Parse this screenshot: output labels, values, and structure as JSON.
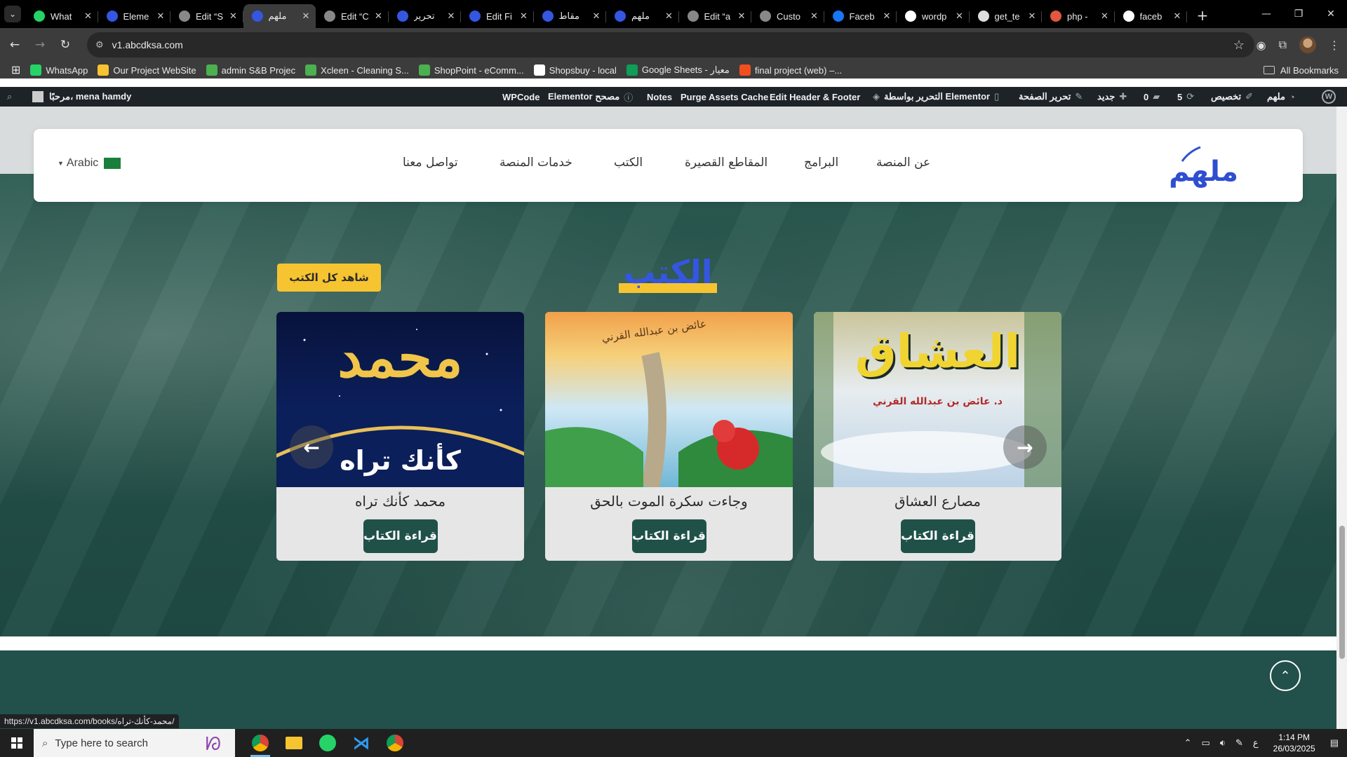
{
  "browser": {
    "tabs": [
      {
        "title": "What",
        "color": "#25d366",
        "glyph": "W"
      },
      {
        "title": "Eleme",
        "color": "#3456e0",
        "glyph": "م"
      },
      {
        "title": "Edit “S",
        "color": "#888888",
        "glyph": ""
      },
      {
        "title": "ملهم",
        "color": "#3456e0",
        "glyph": "م",
        "active": true
      },
      {
        "title": "Edit “C",
        "color": "#888888",
        "glyph": ""
      },
      {
        "title": "تحرير",
        "color": "#3456e0",
        "glyph": "م"
      },
      {
        "title": "Edit Fi",
        "color": "#3456e0",
        "glyph": "م"
      },
      {
        "title": "مقاط",
        "color": "#3456e0",
        "glyph": "م"
      },
      {
        "title": "ملهم",
        "color": "#3456e0",
        "glyph": "م"
      },
      {
        "title": "Edit “a",
        "color": "#888888",
        "glyph": ""
      },
      {
        "title": "Custo",
        "color": "#888888",
        "glyph": ""
      },
      {
        "title": "Faceb",
        "color": "#1877f2",
        "glyph": "f"
      },
      {
        "title": "wordp",
        "color": "#ffffff",
        "glyph": "G"
      },
      {
        "title": "get_te",
        "color": "#dddddd",
        "glyph": "W"
      },
      {
        "title": "php -",
        "color": "#e2583e",
        "glyph": "P"
      },
      {
        "title": "faceb",
        "color": "#ffffff",
        "glyph": "G"
      }
    ],
    "url": "v1.abcdksa.com",
    "status_url": "https://v1.abcdksa.com/books/محمد-كأنك-تراه/"
  },
  "bookmarks": [
    {
      "label": "WhatsApp",
      "color": "#25d366"
    },
    {
      "label": "Our Project WebSite",
      "color": "#f6c431"
    },
    {
      "label": "admin S&B Projec",
      "color": "#4caf50"
    },
    {
      "label": "Xcleen - Cleaning S...",
      "color": "#4caf50"
    },
    {
      "label": "ShopPoint - eComm...",
      "color": "#4caf50"
    },
    {
      "label": "Shopsbuy - local",
      "color": "#ffffff"
    },
    {
      "label": "Google Sheets - معيار",
      "color": "#0f9d58"
    },
    {
      "label": "final project (web) –...",
      "color": "#f24e1e"
    }
  ],
  "bookmarks_all": "All Bookmarks",
  "wpbar": {
    "greeting": "مرحبًا، mena hamdy",
    "wpcode": "WPCode",
    "elementor_debugger": "Elementor مصحح",
    "notes": "Notes",
    "purge": "Purge Assets Cache",
    "edit_hf": "Edit Header & Footer",
    "edit_elementor": "التحرير بواسطة Elementor",
    "edit_page": "تحرير الصفحة",
    "new": "جديد",
    "comments": "0",
    "updates": "5",
    "customize": "تخصيص",
    "site": "ملهم"
  },
  "site": {
    "logo": "ملهم",
    "menu": [
      "عن المنصة",
      "البرامج",
      "المقاطع القصيرة",
      "الكتب",
      "خدمات المنصة",
      "تواصل معنا"
    ],
    "lang": "Arabic"
  },
  "books_section": {
    "title": "الكتب",
    "view_all": "شاهد كل الكتب",
    "books": [
      {
        "title": "محمد كأنك تراه",
        "button": "قراءة الكتاب",
        "cover_text": "محمد",
        "cover_sub": "كأنك تراه"
      },
      {
        "title": "وجاءت سكرة الموت بالحق",
        "button": "قراءة الكتاب",
        "cover_text": "عائض بن عبدالله القرني"
      },
      {
        "title": "مصارع العشاق",
        "button": "قراءة الكتاب",
        "cover_text": "العشاق",
        "cover_sub": "د. عائض بن عبدالله القرني"
      }
    ]
  },
  "taskbar": {
    "search_placeholder": "Type here to search",
    "time": "1:14 PM",
    "date": "26/03/2025",
    "lang_indicator": "ع"
  }
}
